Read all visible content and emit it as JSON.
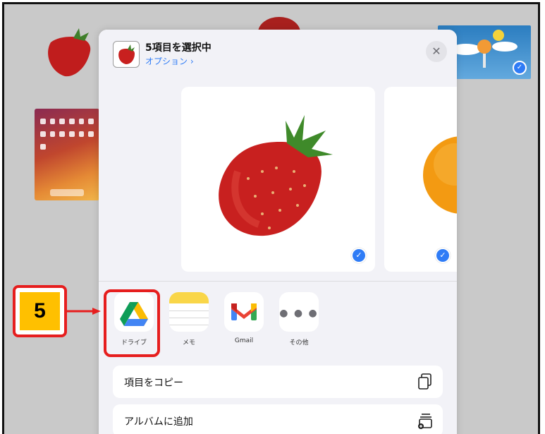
{
  "sheet": {
    "title": "5項目を選択中",
    "options_link": "オプション ›",
    "close_glyph": "✕"
  },
  "apps": [
    {
      "label": "ドライブ",
      "icon": "google-drive-icon"
    },
    {
      "label": "メモ",
      "icon": "notes-icon"
    },
    {
      "label": "Gmail",
      "icon": "gmail-icon"
    },
    {
      "label": "その他",
      "icon": "more-icon"
    }
  ],
  "actions": [
    {
      "label": "項目をコピー",
      "icon": "copy-icon"
    },
    {
      "label": "アルバムに追加",
      "icon": "add-to-album-icon"
    }
  ],
  "annotation": {
    "step_number": "5"
  },
  "colors": {
    "accent": "#2f7cf6",
    "annotation_border": "#e61e1e",
    "annotation_fill": "#ffc000"
  }
}
